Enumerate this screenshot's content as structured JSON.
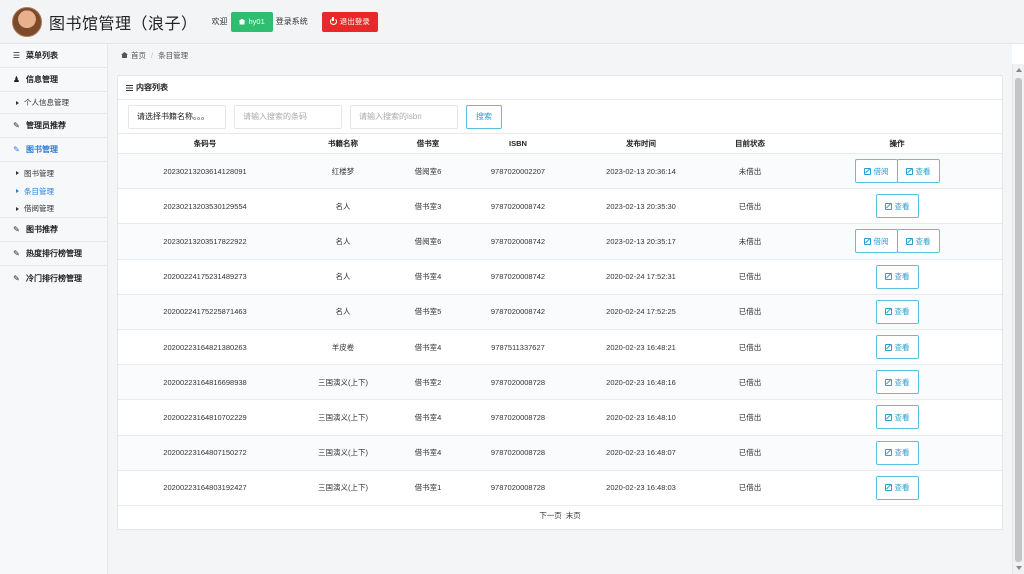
{
  "header": {
    "title": "图书馆管理（浪子）",
    "welcome": "欢迎",
    "username": "hy01",
    "login_system": "登录系统",
    "logout": "退出登录",
    "colors": {
      "user_badge": "#2fbe6f",
      "logout": "#e8292a"
    }
  },
  "sidebar": {
    "menu_title": "菜单列表",
    "sections": [
      {
        "label": "信息管理",
        "icon": "user-icon",
        "active": false,
        "subs": [
          "个人信息管理"
        ]
      },
      {
        "label": "管理员推荐",
        "icon": "edit-icon",
        "active": false,
        "subs": []
      },
      {
        "label": "图书管理",
        "icon": "edit-icon",
        "active": true,
        "subs": [
          "图书管理",
          "条目管理",
          "借阅管理"
        ]
      },
      {
        "label": "图书推荐",
        "icon": "edit-icon",
        "active": false,
        "subs": []
      },
      {
        "label": "热度排行榜管理",
        "icon": "edit-icon",
        "active": false,
        "subs": []
      },
      {
        "label": "冷门排行榜管理",
        "icon": "edit-icon",
        "active": false,
        "subs": []
      }
    ],
    "active_sub": "条目管理",
    "accent": "#2b7fd8"
  },
  "breadcrumb": {
    "home": "首页",
    "current": "条目管理"
  },
  "panel": {
    "title": "内容列表",
    "search": {
      "select_value": "请选择书籍名称。。。",
      "barcode_placeholder": "请输入搜索的条码",
      "isbn_placeholder": "请输入搜索的isbn",
      "button": "搜索"
    },
    "columns": [
      "条码号",
      "书籍名称",
      "借书室",
      "ISBN",
      "发布时间",
      "目前状态",
      "操作"
    ],
    "rows": [
      {
        "barcode": "20230213203614128091",
        "name": "红楼梦",
        "room": "借阅室6",
        "isbn": "9787020002207",
        "time": "2023-02-13 20:36:14",
        "status": "未借出",
        "actions": [
          "借阅",
          "查看"
        ]
      },
      {
        "barcode": "20230213203530129554",
        "name": "名人",
        "room": "借书室3",
        "isbn": "9787020008742",
        "time": "2023-02-13 20:35:30",
        "status": "已借出",
        "actions": [
          "查看"
        ]
      },
      {
        "barcode": "20230213203517822922",
        "name": "名人",
        "room": "借阅室6",
        "isbn": "9787020008742",
        "time": "2023-02-13 20:35:17",
        "status": "未借出",
        "actions": [
          "借阅",
          "查看"
        ]
      },
      {
        "barcode": "20200224175231489273",
        "name": "名人",
        "room": "借书室4",
        "isbn": "9787020008742",
        "time": "2020-02-24 17:52:31",
        "status": "已借出",
        "actions": [
          "查看"
        ]
      },
      {
        "barcode": "20200224175225871463",
        "name": "名人",
        "room": "借书室5",
        "isbn": "9787020008742",
        "time": "2020-02-24 17:52:25",
        "status": "已借出",
        "actions": [
          "查看"
        ]
      },
      {
        "barcode": "20200223164821380263",
        "name": "羊皮卷",
        "room": "借书室4",
        "isbn": "9787511337627",
        "time": "2020-02-23 16:48:21",
        "status": "已借出",
        "actions": [
          "查看"
        ]
      },
      {
        "barcode": "20200223164816698938",
        "name": "三国演义(上下)",
        "room": "借书室2",
        "isbn": "9787020008728",
        "time": "2020-02-23 16:48:16",
        "status": "已借出",
        "actions": [
          "查看"
        ]
      },
      {
        "barcode": "20200223164810702229",
        "name": "三国演义(上下)",
        "room": "借书室4",
        "isbn": "9787020008728",
        "time": "2020-02-23 16:48:10",
        "status": "已借出",
        "actions": [
          "查看"
        ]
      },
      {
        "barcode": "20200223164807150272",
        "name": "三国演义(上下)",
        "room": "借书室4",
        "isbn": "9787020008728",
        "time": "2020-02-23 16:48:07",
        "status": "已借出",
        "actions": [
          "查看"
        ]
      },
      {
        "barcode": "20200223164803192427",
        "name": "三国演义(上下)",
        "room": "借书室1",
        "isbn": "9787020008728",
        "time": "2020-02-23 16:48:03",
        "status": "已借出",
        "actions": [
          "查看"
        ]
      }
    ],
    "pager": {
      "next": "下一页",
      "last": "末页"
    }
  }
}
